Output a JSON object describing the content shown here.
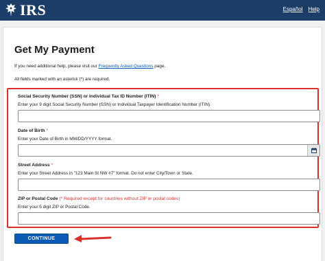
{
  "header": {
    "logo_text": "IRS",
    "links": [
      "Español",
      "Help"
    ]
  },
  "page": {
    "title": "Get My Payment",
    "help_prefix": "If you need additional help, please visit our ",
    "help_link": "Frequently Asked Questions",
    "help_suffix": " page.",
    "required_note": "All fields marked with an asterisk (*) are required."
  },
  "form": {
    "ssn": {
      "label": "Social Security Number (SSN) or Individual Tax ID Number (ITIN)",
      "asterisk": "*",
      "hint": "Enter your 9 digit Social Security Number (SSN) or Individual Taxpayer Identification Number (ITIN).",
      "value": ""
    },
    "dob": {
      "label": "Date of Birth",
      "asterisk": "*",
      "hint": "Enter your Date of Birth in MM/DD/YYYY format.",
      "value": ""
    },
    "address": {
      "label": "Street Address",
      "asterisk": "*",
      "hint": "Enter your Street Address in \"123 Main St NW #7\" format. Do not enter City/Town or State.",
      "value": ""
    },
    "zip": {
      "label": "ZIP or Postal Code",
      "note": "(* Required except for countries without ZIP or postal codes)",
      "hint": "Enter your 5 digit ZIP or Postal Code.",
      "value": ""
    },
    "continue_label": "CONTINUE"
  },
  "colors": {
    "header_bg": "#1b3d68",
    "highlight_border": "#d9312a",
    "button_bg": "#0b5ab3",
    "link": "#0b5ab3"
  }
}
